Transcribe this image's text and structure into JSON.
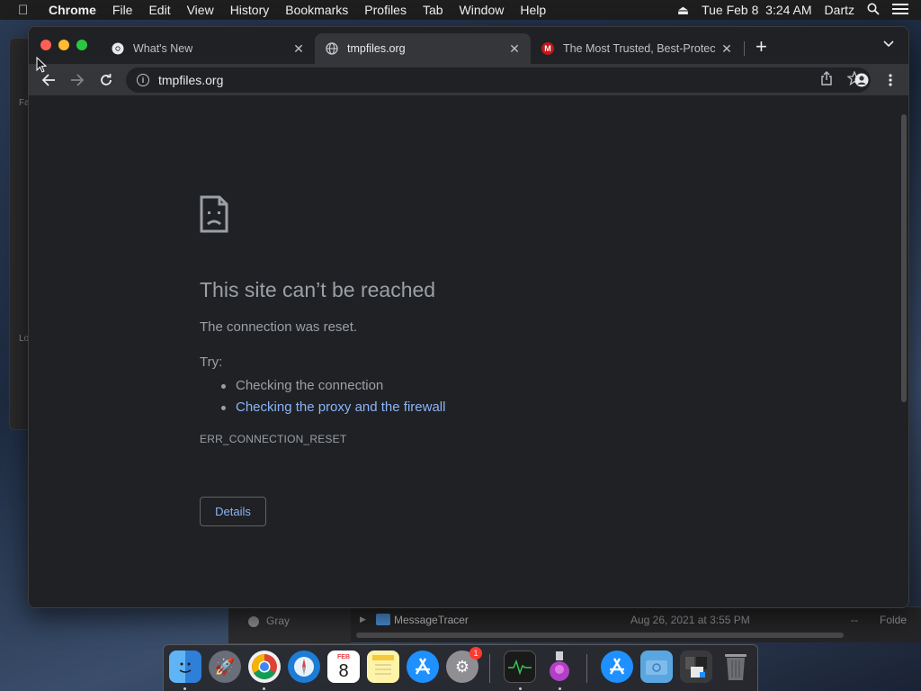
{
  "menubar": {
    "app_name": "Chrome",
    "items": [
      "File",
      "Edit",
      "View",
      "History",
      "Bookmarks",
      "Profiles",
      "Tab",
      "Window",
      "Help"
    ],
    "datetime": "Tue Feb 8  3:24 AM",
    "user": "Dartz"
  },
  "tabs": [
    {
      "title": "What's New",
      "icon": "chrome-icon",
      "active": false
    },
    {
      "title": "tmpfiles.org",
      "icon": "globe-icon",
      "active": true
    },
    {
      "title": "The Most Trusted, Best-Protec",
      "icon": "mcafee-icon",
      "active": false
    }
  ],
  "toolbar": {
    "url": "tmpfiles.org"
  },
  "error_page": {
    "title": "This site can’t be reached",
    "subtitle": "The connection was reset.",
    "try_label": "Try:",
    "suggestions": [
      "Checking the connection",
      "Checking the proxy and the firewall"
    ],
    "error_code": "ERR_CONNECTION_RESET",
    "details_button": "Details"
  },
  "background_finder": {
    "sidebar_fragments": [
      "Fa",
      "Lo"
    ],
    "tag_label": "Gray",
    "row": {
      "name": "MessageTracer",
      "date": "Aug 26, 2021 at 3:55 PM",
      "size": "--",
      "kind": "Folde"
    }
  },
  "dock": {
    "apps": [
      "Finder",
      "Launchpad",
      "Google Chrome",
      "Safari",
      "Calendar",
      "Notes",
      "App Store",
      "System Preferences",
      "Activity Monitor",
      "Installer",
      "App Store",
      "Downloads",
      "Stack",
      "Trash"
    ],
    "calendar_month": "FEB",
    "calendar_day": "8",
    "badge_count": "1"
  },
  "colors": {
    "link": "#8ab4f8",
    "error_text": "#9aa0a6",
    "page_bg": "#202124",
    "toolbar_bg": "#35363a"
  }
}
